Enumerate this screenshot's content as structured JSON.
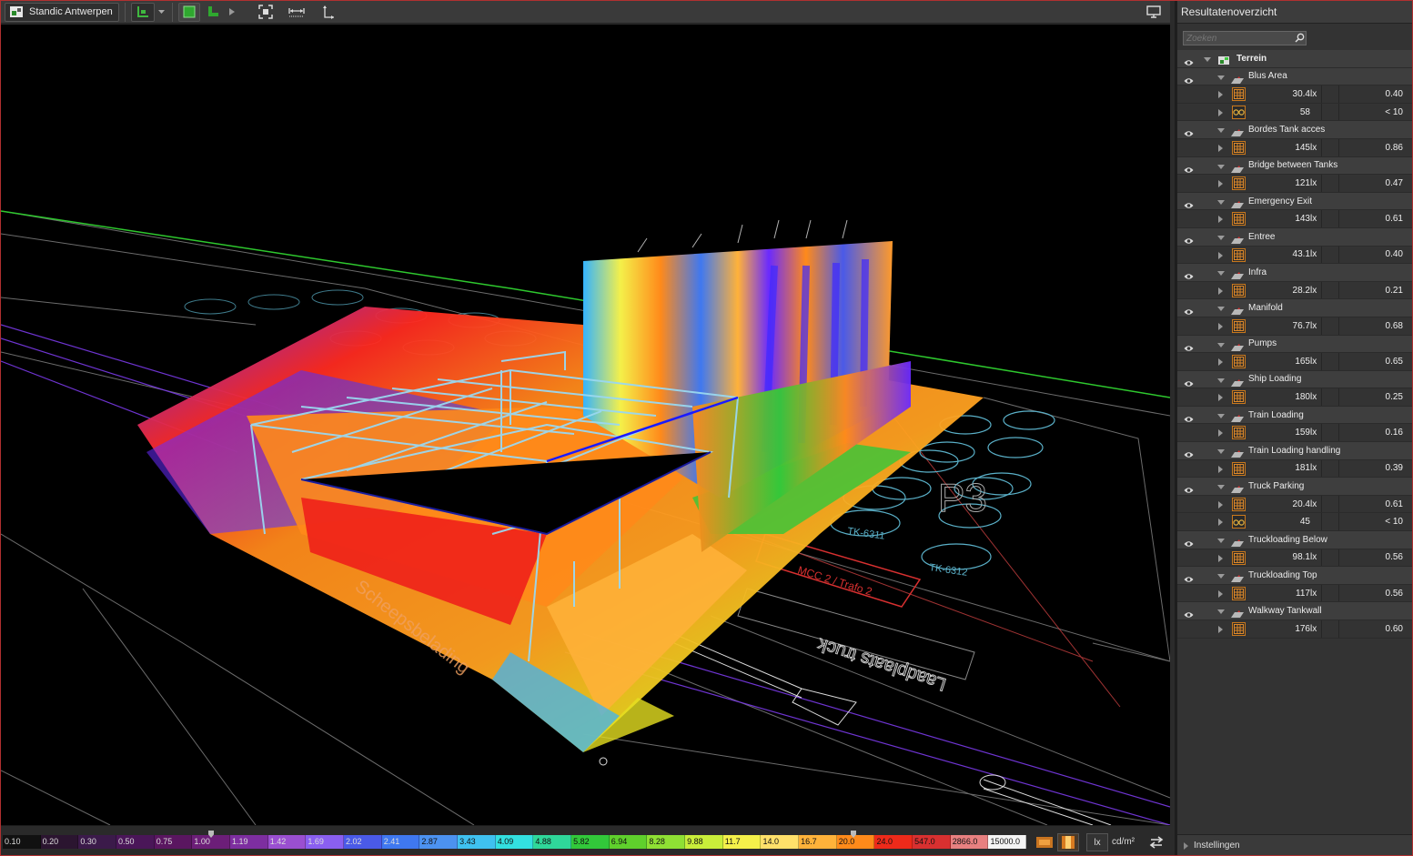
{
  "toolbar": {
    "project_label": "Standic Antwerpen",
    "icons": [
      "project-icon",
      "view-mode-icon",
      "dropdown-arrow-icon",
      "solid-view-icon",
      "wireframe-view-icon",
      "play-arrow-icon",
      "fit-to-view-icon",
      "measure-horizontal-icon",
      "measure-vertical-icon",
      "screen-icon"
    ]
  },
  "viewport": {
    "scene_labels": [
      "Scheepsbelading",
      "Laadplaats truck",
      "MCC 2 / Trafo 2",
      "TK-6311",
      "TK-6312",
      "P3"
    ]
  },
  "legend": {
    "values": [
      "0.10",
      "0.20",
      "0.30",
      "0.50",
      "0.75",
      "1.00",
      "1.19",
      "1.42",
      "1.69",
      "2.02",
      "2.41",
      "2.87",
      "3.43",
      "4.09",
      "4.88",
      "5.82",
      "6.94",
      "8.28",
      "9.88",
      "11.7",
      "14.0",
      "16.7",
      "20.0",
      "24.0",
      "547.0",
      "2866.0",
      "15000.0"
    ],
    "colors": [
      "#111111",
      "#2b1530",
      "#3b1a4a",
      "#4a1658",
      "#5a1660",
      "#6c1e78",
      "#7d2ea0",
      "#9a4fd0",
      "#8a5ff0",
      "#4a5ae8",
      "#3f78f0",
      "#4c92f0",
      "#3fc1f0",
      "#33e0e0",
      "#2fd79a",
      "#32c83a",
      "#5fd02c",
      "#8fe034",
      "#c9ee3a",
      "#f4f04a",
      "#ffe06a",
      "#ffb23a",
      "#ff8a1a",
      "#ee2a1a",
      "#d83030",
      "#e88080",
      "#f4f4f4"
    ],
    "unit_lx": "lx",
    "unit_cd": "cd/m²"
  },
  "panel": {
    "title": "Resultatenoverzicht",
    "search_placeholder": "Zoeken",
    "root_label": "Terrein",
    "groups": [
      {
        "name": "Blus Area",
        "rows": [
          {
            "icon": "grid-icon",
            "value": "30.4",
            "unit": "lx",
            "ratio": "0.40"
          },
          {
            "icon": "glasses-icon",
            "value": "58",
            "unit": "",
            "ratio": "< 10"
          }
        ]
      },
      {
        "name": "Bordes Tank acces",
        "rows": [
          {
            "icon": "grid-icon",
            "value": "145",
            "unit": "lx",
            "ratio": "0.86"
          }
        ]
      },
      {
        "name": "Bridge between Tanks",
        "rows": [
          {
            "icon": "grid-icon",
            "value": "121",
            "unit": "lx",
            "ratio": "0.47"
          }
        ]
      },
      {
        "name": "Emergency Exit",
        "rows": [
          {
            "icon": "grid-icon",
            "value": "143",
            "unit": "lx",
            "ratio": "0.61"
          }
        ]
      },
      {
        "name": "Entree",
        "rows": [
          {
            "icon": "grid-icon",
            "value": "43.1",
            "unit": "lx",
            "ratio": "0.40"
          }
        ]
      },
      {
        "name": "Infra",
        "rows": [
          {
            "icon": "grid-icon",
            "value": "28.2",
            "unit": "lx",
            "ratio": "0.21"
          }
        ]
      },
      {
        "name": "Manifold",
        "rows": [
          {
            "icon": "grid-icon",
            "value": "76.7",
            "unit": "lx",
            "ratio": "0.68"
          }
        ]
      },
      {
        "name": "Pumps",
        "rows": [
          {
            "icon": "grid-icon",
            "value": "165",
            "unit": "lx",
            "ratio": "0.65"
          }
        ]
      },
      {
        "name": "Ship Loading",
        "rows": [
          {
            "icon": "grid-icon",
            "value": "180",
            "unit": "lx",
            "ratio": "0.25"
          }
        ]
      },
      {
        "name": "Train Loading",
        "rows": [
          {
            "icon": "grid-icon",
            "value": "159",
            "unit": "lx",
            "ratio": "0.16"
          }
        ]
      },
      {
        "name": "Train Loading handling",
        "rows": [
          {
            "icon": "grid-icon",
            "value": "181",
            "unit": "lx",
            "ratio": "0.39"
          }
        ]
      },
      {
        "name": "Truck Parking",
        "rows": [
          {
            "icon": "grid-icon",
            "value": "20.4",
            "unit": "lx",
            "ratio": "0.61"
          },
          {
            "icon": "glasses-icon",
            "value": "45",
            "unit": "",
            "ratio": "< 10"
          }
        ]
      },
      {
        "name": "Truckloading Below",
        "rows": [
          {
            "icon": "grid-icon",
            "value": "98.1",
            "unit": "lx",
            "ratio": "0.56"
          }
        ]
      },
      {
        "name": "Truckloading Top",
        "rows": [
          {
            "icon": "grid-icon",
            "value": "117",
            "unit": "lx",
            "ratio": "0.56"
          }
        ]
      },
      {
        "name": "Walkway Tankwall",
        "rows": [
          {
            "icon": "grid-icon",
            "value": "176",
            "unit": "lx",
            "ratio": "0.60"
          }
        ]
      }
    ],
    "footer_label": "Instellingen"
  }
}
